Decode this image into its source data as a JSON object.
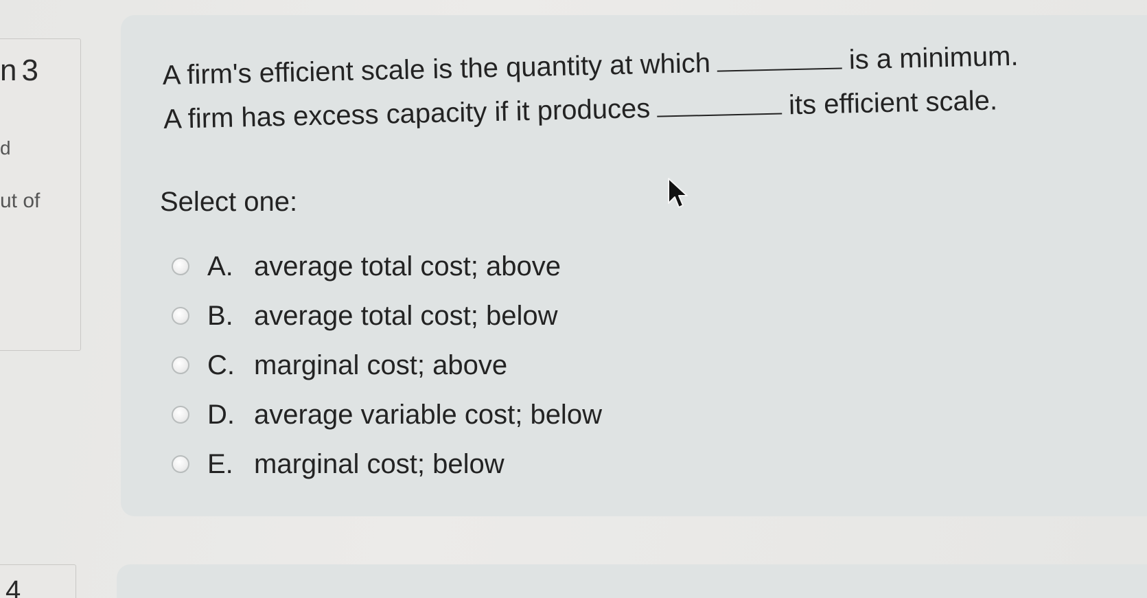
{
  "sidebar": {
    "question_number": "3",
    "question_number_fragment": "n",
    "status_fragment": "d",
    "mark_fragment": "ut of",
    "next_question_fragment": "4"
  },
  "question": {
    "line1_before": "A firm's efficient scale is the quantity at which",
    "line1_after": "is a minimum.",
    "line2_before": "A firm has excess capacity if it produces",
    "line2_after": "its efficient scale."
  },
  "prompt": "Select one:",
  "options": [
    {
      "letter": "A.",
      "text": "average total cost; above"
    },
    {
      "letter": "B.",
      "text": "average total cost; below"
    },
    {
      "letter": "C.",
      "text": "marginal cost; above"
    },
    {
      "letter": "D.",
      "text": "average variable cost; below"
    },
    {
      "letter": "E.",
      "text": "marginal cost; below"
    }
  ],
  "icons": {
    "cursor": "mouse-pointer-icon"
  }
}
